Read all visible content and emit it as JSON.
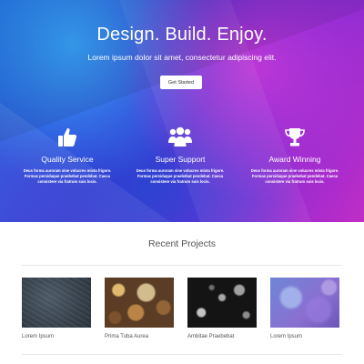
{
  "hero": {
    "title": "Design. Build. Enjoy.",
    "subtitle": "Lorem ipsum dolor sit amet, consectetur adipiscing elit.",
    "cta_label": "Get Started"
  },
  "features": [
    {
      "icon": "thumbs-up-icon",
      "title": "Quality Service",
      "description": "Deus forma auroram sine volucres mista frigore. Formas persidaque praebebat pendebat. Caeca consistere via fratrum suis locis."
    },
    {
      "icon": "users-icon",
      "title": "Super Support",
      "description": "Deus forma auroram sine volucres mista frigore. Formas persidaque praebebat pendebat. Caeca consistere via fratrum suis locis."
    },
    {
      "icon": "trophy-icon",
      "title": "Award Winning",
      "description": "Deus forma auroram sine volucres mista frigore. Formas persidaque praebebat pendebat. Caeca consistere via fratrum suis locis."
    }
  ],
  "projects": {
    "title": "Recent Projects",
    "items": [
      {
        "caption": "Lorem Ipsum"
      },
      {
        "caption": "Prima Tuba Aurea"
      },
      {
        "caption": "Ambitae Praebebat"
      },
      {
        "caption": "Lorem Ipsum"
      }
    ]
  }
}
